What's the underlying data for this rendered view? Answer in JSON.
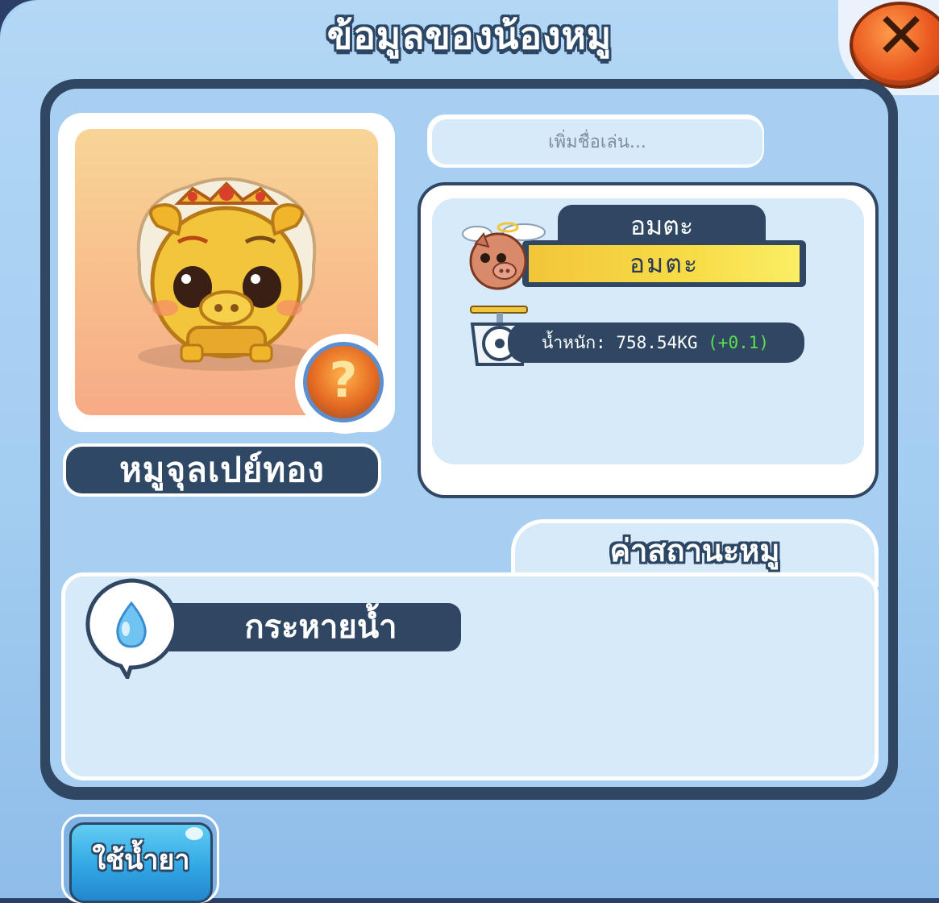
{
  "window": {
    "title": "ข้อมูลของน้องหมู",
    "close_icon": "close-x-icon"
  },
  "pig": {
    "name": "หมูจุลเปย์ทอง",
    "nickname_placeholder": "เพิ่มชื่อเล่น...",
    "portrait_icon": "golden-pig-icon",
    "badge_icon": "question-badge-icon"
  },
  "status": {
    "tab_label": "อมตะ",
    "bar_value": "อมตะ",
    "icon": "angel-pig-icon"
  },
  "weight": {
    "label": "น้ำหนัก: 758.54KG",
    "delta": "(+0.1)",
    "icon": "scale-icon"
  },
  "stats": {
    "tab_label": "ค่าสถานะหมู",
    "trait": "กระหายน้ำ",
    "trait_icon": "water-drop-icon"
  },
  "actions": {
    "potion_button": "ใช้น้ำยา"
  },
  "colors": {
    "panel_dark": "#2f4763",
    "panel_light": "#a7cff1",
    "status_yellow": "#f7dc47",
    "close_red": "#e8561e",
    "delta_green": "#5ce04d"
  }
}
